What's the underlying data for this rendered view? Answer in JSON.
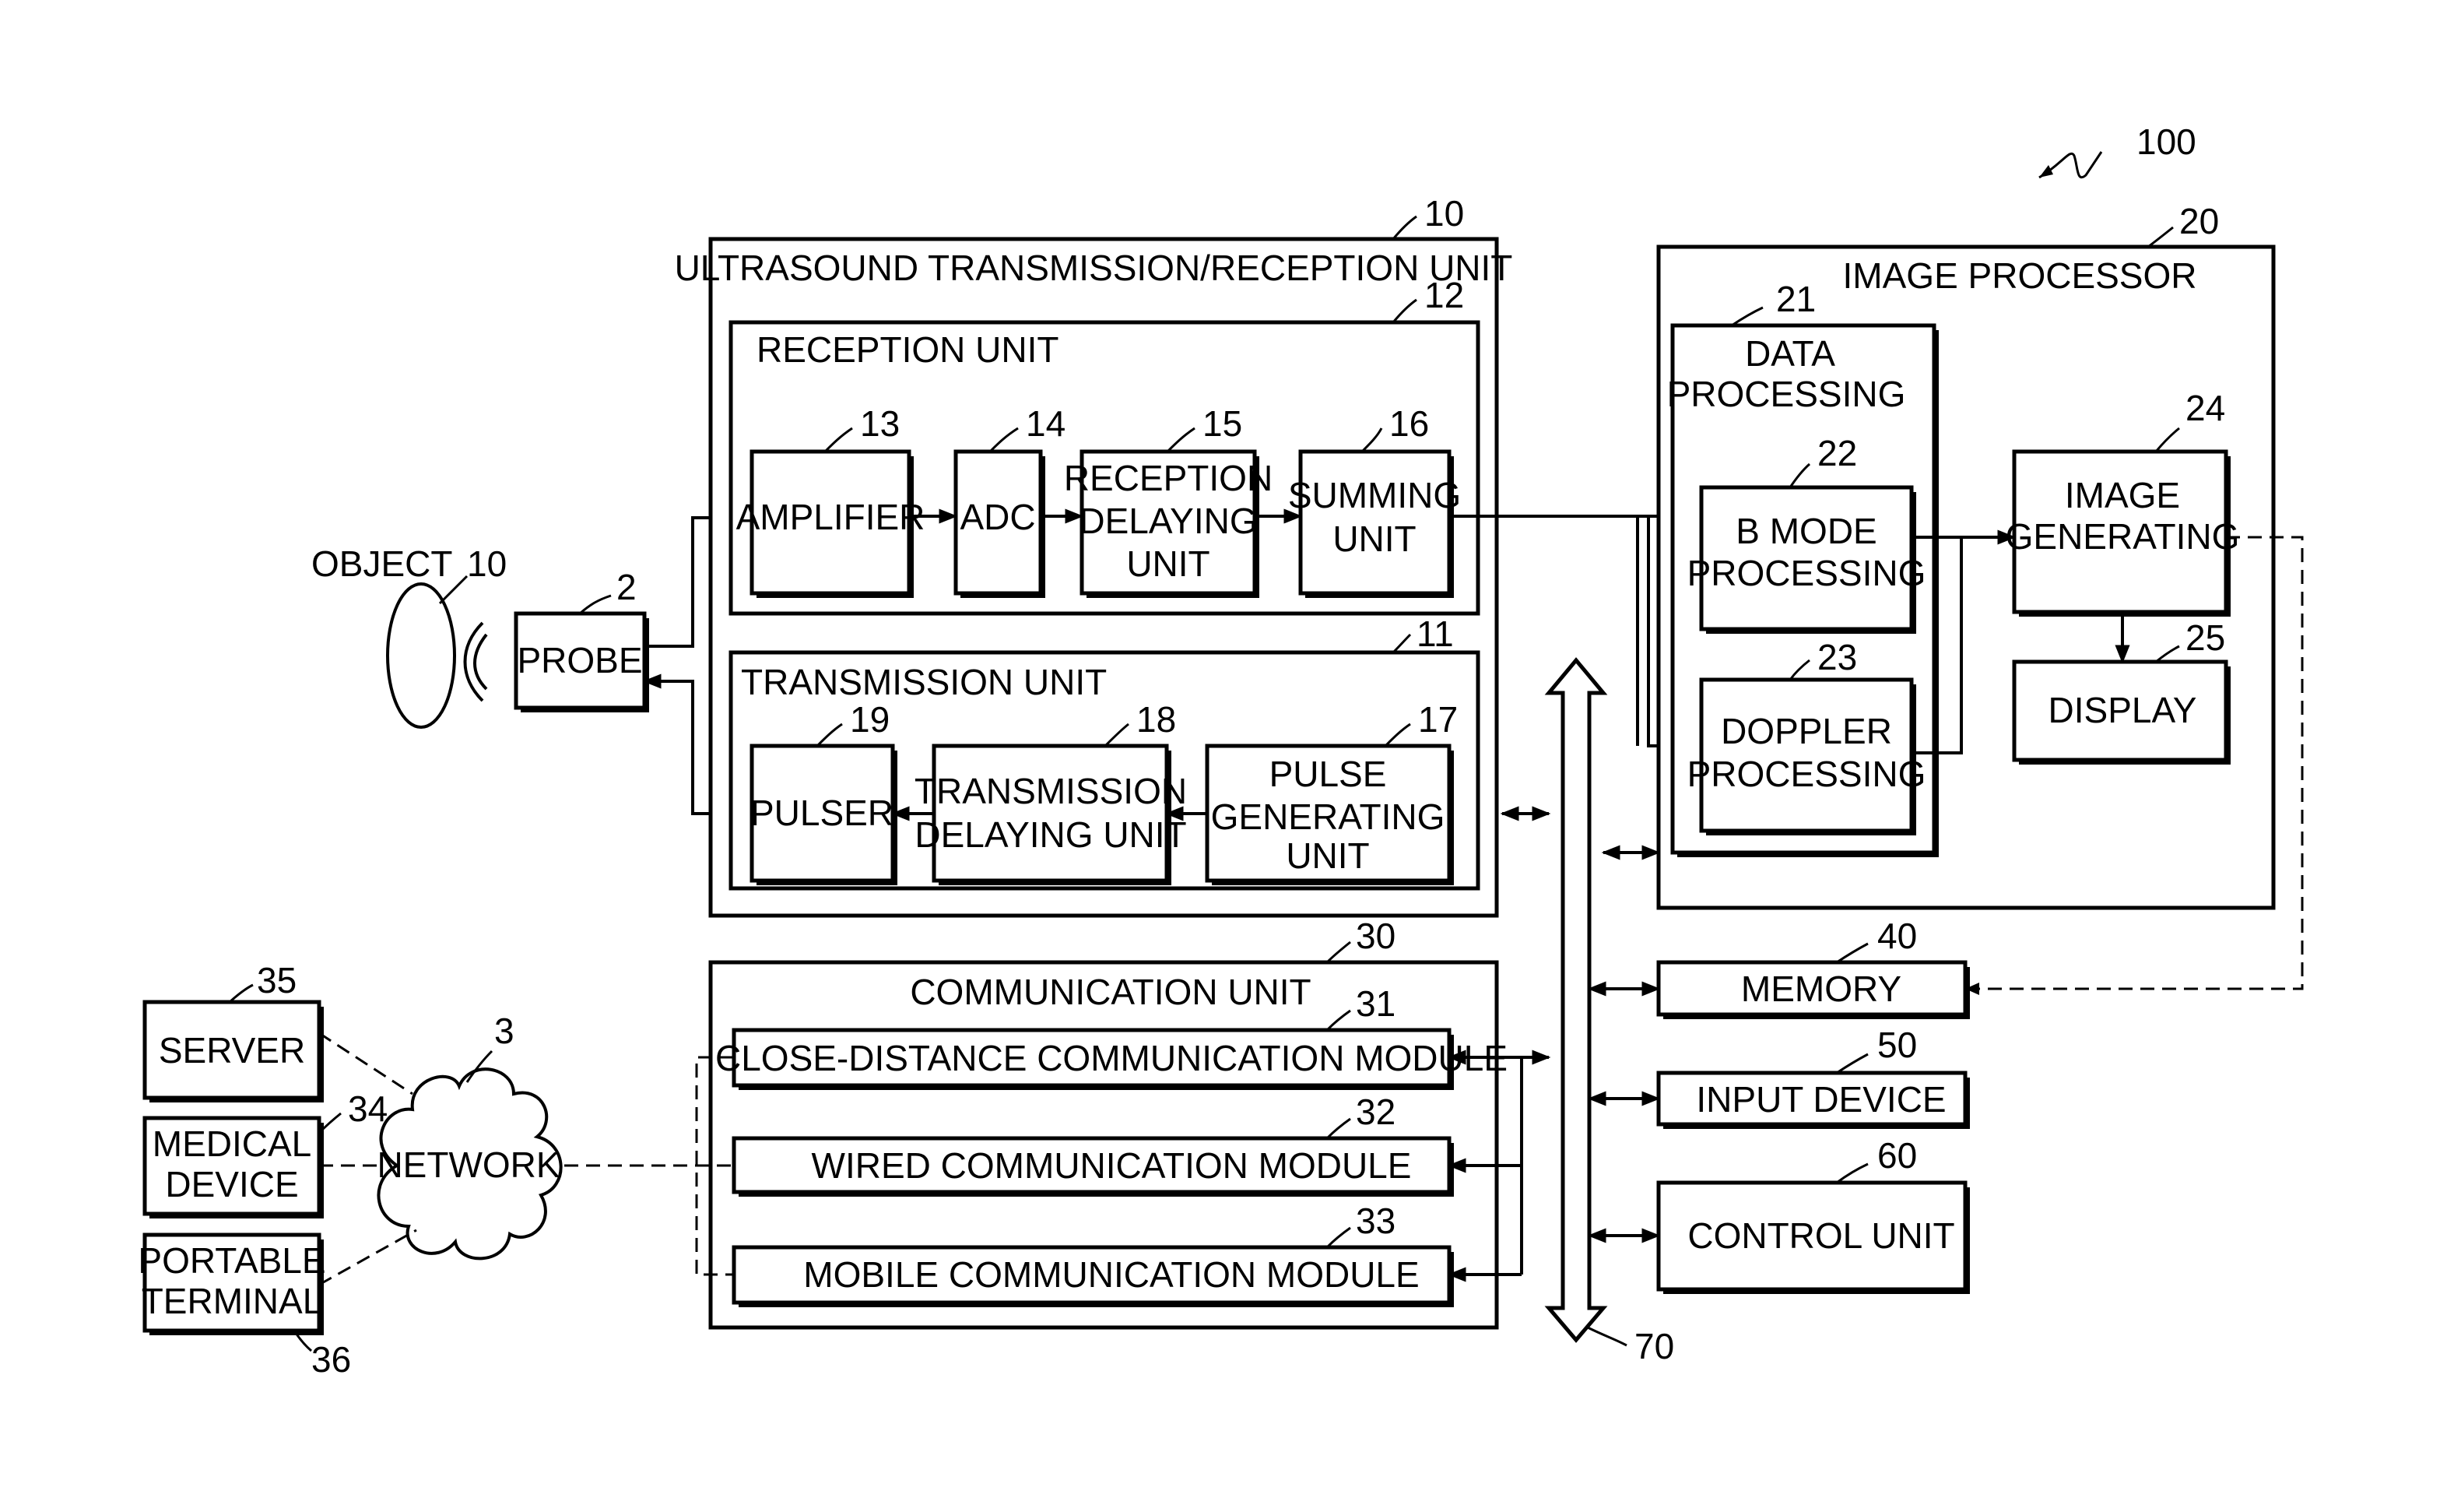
{
  "figure": {
    "reference": "100",
    "colors": {
      "stroke": "#000000",
      "background": "#ffffff"
    }
  },
  "object": {
    "label": "OBJECT",
    "ref": "10"
  },
  "probe": {
    "label": "PROBE",
    "ref": "2"
  },
  "ultrasound_unit": {
    "title": "ULTRASOUND TRANSMISSION/RECEPTION UNIT",
    "ref": "10",
    "reception": {
      "title": "RECEPTION UNIT",
      "ref": "12",
      "blocks": [
        {
          "lines": [
            "AMPLIFIER"
          ],
          "ref": "13"
        },
        {
          "lines": [
            "ADC"
          ],
          "ref": "14"
        },
        {
          "lines": [
            "RECEPTION",
            "DELAYING",
            "UNIT"
          ],
          "ref": "15"
        },
        {
          "lines": [
            "SUMMING",
            "UNIT"
          ],
          "ref": "16"
        }
      ]
    },
    "transmission": {
      "title": "TRANSMISSION UNIT",
      "ref": "11",
      "blocks": [
        {
          "lines": [
            "PULSER"
          ],
          "ref": "19"
        },
        {
          "lines": [
            "TRANSMISSION",
            "DELAYING UNIT"
          ],
          "ref": "18"
        },
        {
          "lines": [
            "PULSE",
            "GENERATING",
            "UNIT"
          ],
          "ref": "17"
        }
      ]
    }
  },
  "image_processor": {
    "title": "IMAGE PROCESSOR",
    "ref": "20",
    "data_processing": {
      "lines": [
        "DATA",
        "PROCESSING"
      ],
      "ref": "21",
      "b_mode": {
        "lines": [
          "B MODE",
          "PROCESSING"
        ],
        "ref": "22"
      },
      "doppler": {
        "lines": [
          "DOPPLER",
          "PROCESSING"
        ],
        "ref": "23"
      }
    },
    "image_generating": {
      "lines": [
        "IMAGE",
        "GENERATING"
      ],
      "ref": "24"
    },
    "display": {
      "label": "DISPLAY",
      "ref": "25"
    }
  },
  "communication_unit": {
    "title": "COMMUNICATION UNIT",
    "ref": "30",
    "modules": [
      {
        "label": "CLOSE-DISTANCE COMMUNICATION MODULE",
        "ref": "31"
      },
      {
        "label": "WIRED COMMUNICATION MODULE",
        "ref": "32"
      },
      {
        "label": "MOBILE COMMUNICATION MODULE",
        "ref": "33"
      }
    ]
  },
  "network": {
    "label": "NETWORK",
    "ref": "3"
  },
  "external_devices": [
    {
      "lines": [
        "SERVER"
      ],
      "ref": "35"
    },
    {
      "lines": [
        "MEDICAL",
        "DEVICE"
      ],
      "ref": "34"
    },
    {
      "lines": [
        "PORTABLE",
        "TERMINAL"
      ],
      "ref": "36"
    }
  ],
  "memory": {
    "label": "MEMORY",
    "ref": "40"
  },
  "input_device": {
    "label": "INPUT DEVICE",
    "ref": "50"
  },
  "control_unit": {
    "label": "CONTROL UNIT",
    "ref": "60"
  },
  "bus": {
    "ref": "70"
  }
}
